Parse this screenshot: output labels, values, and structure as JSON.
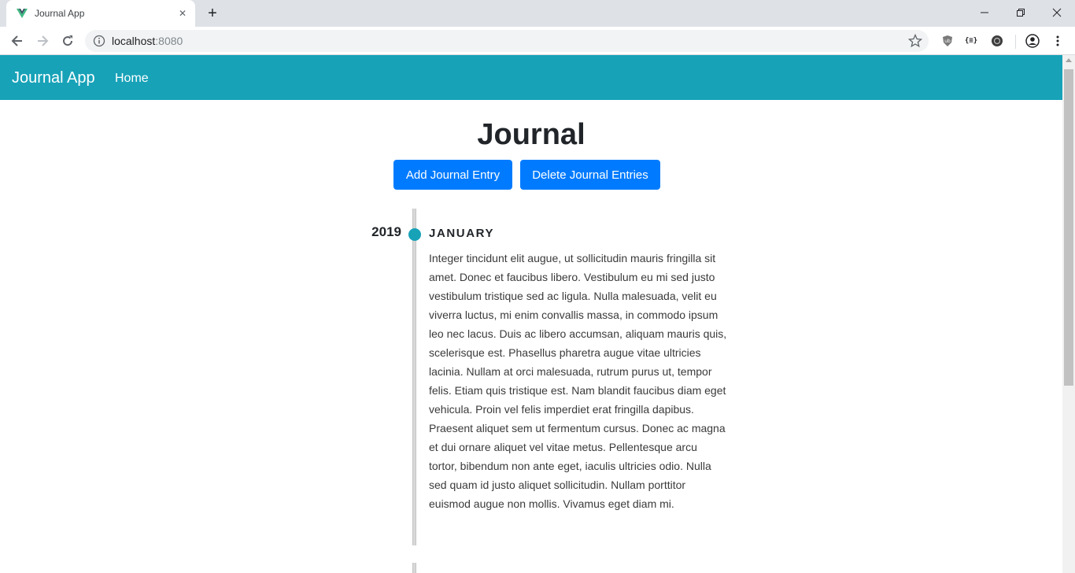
{
  "browser": {
    "tab_title": "Journal App",
    "url_host": "localhost",
    "url_port": ":8080",
    "new_tab_symbol": "+",
    "tab_close_symbol": "✕",
    "extension_text": "{≡}"
  },
  "app": {
    "brand": "Journal App",
    "nav_home": "Home",
    "accent_color": "#17a2b8",
    "button_color": "#007bff"
  },
  "main": {
    "title": "Journal",
    "add_button": "Add Journal Entry",
    "delete_button": "Delete Journal Entries"
  },
  "timeline": {
    "entries": [
      {
        "year": "2019",
        "month": "JANUARY",
        "text": "Integer tincidunt elit augue, ut sollicitudin mauris fringilla sit amet. Donec et faucibus libero. Vestibulum eu mi sed justo vestibulum tristique sed ac ligula. Nulla malesuada, velit eu viverra luctus, mi enim convallis massa, in commodo ipsum leo nec lacus. Duis ac libero accumsan, aliquam mauris quis, scelerisque est. Phasellus pharetra augue vitae ultricies lacinia. Nullam at orci malesuada, rutrum purus ut, tempor felis. Etiam quis tristique est. Nam blandit faucibus diam eget vehicula. Proin vel felis imperdiet erat fringilla dapibus. Praesent aliquet sem ut fermentum cursus. Donec ac magna et dui ornare aliquet vel vitae metus. Pellentesque arcu tortor, bibendum non ante eget, iaculis ultricies odio. Nulla sed quam id justo aliquet sollicitudin. Nullam porttitor euismod augue non mollis. Vivamus eget diam mi."
      }
    ]
  }
}
